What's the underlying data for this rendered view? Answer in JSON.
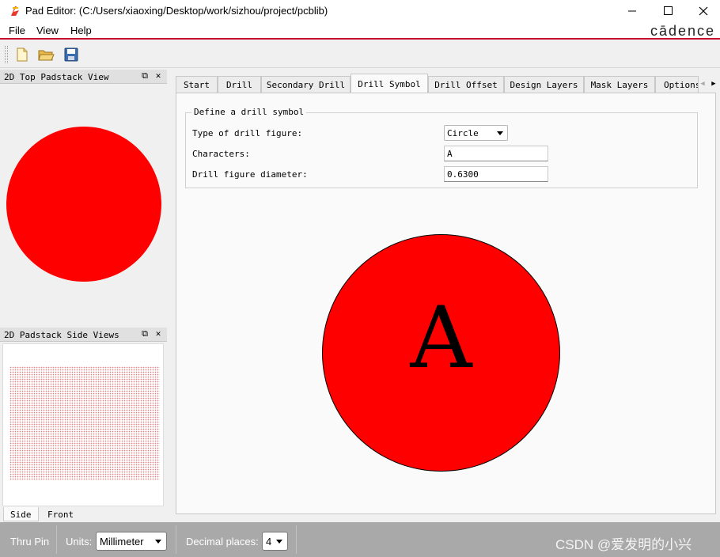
{
  "window": {
    "title": "Pad Editor:   (C:/Users/xiaoxing/Desktop/work/sizhou/project/pcblib)",
    "brand": "cādence"
  },
  "menu": {
    "file": "File",
    "view": "View",
    "help": "Help"
  },
  "toolbar": {
    "new": "new-file-icon",
    "open": "open-folder-icon",
    "save": "save-disk-icon"
  },
  "left_panels": {
    "top_view": {
      "title": "2D Top Padstack View",
      "pad_color": "#ff0000"
    },
    "side_views": {
      "title": "2D Padstack Side Views",
      "tabs": [
        "Side",
        "Front"
      ]
    }
  },
  "tabs": [
    {
      "label": "Start"
    },
    {
      "label": "Drill"
    },
    {
      "label": "Secondary Drill"
    },
    {
      "label": "Drill Symbol",
      "active": true
    },
    {
      "label": "Drill Offset"
    },
    {
      "label": "Design Layers"
    },
    {
      "label": "Mask Layers"
    },
    {
      "label": "Options"
    }
  ],
  "drill_symbol": {
    "group_title": "Define a drill symbol",
    "type_label": "Type of drill figure:",
    "type_value": "Circle",
    "characters_label": "Characters:",
    "characters_value": "A",
    "diameter_label": "Drill figure diameter:",
    "diameter_value": "0.6300",
    "preview_char": "A",
    "preview_color": "#ff0000"
  },
  "statusbar": {
    "pin_type": "Thru Pin",
    "units_label": "Units:",
    "units_value": "Millimeter",
    "decimal_label": "Decimal places:",
    "decimal_value": "4",
    "watermark": "CSDN @爱发明的小兴"
  }
}
